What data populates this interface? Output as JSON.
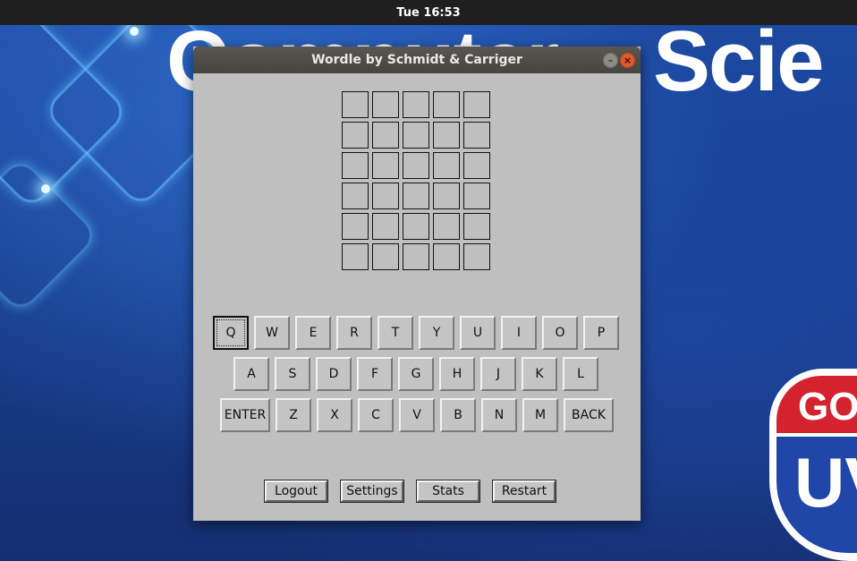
{
  "topbar": {
    "clock": "Tue 16:53"
  },
  "wallpaper": {
    "title_left": "Computer",
    "title_right": "Scie",
    "shield_top": "GO",
    "shield_bottom": "UV"
  },
  "window": {
    "title": "Wordle by Schmidt & Carriger",
    "minimize_icon": "minimize-icon",
    "close_icon": "close-icon",
    "grid": {
      "rows": 6,
      "cols": 5
    },
    "keyboard": {
      "row1": [
        "Q",
        "W",
        "E",
        "R",
        "T",
        "Y",
        "U",
        "I",
        "O",
        "P"
      ],
      "row2": [
        "A",
        "S",
        "D",
        "F",
        "G",
        "H",
        "J",
        "K",
        "L"
      ],
      "row3": [
        "ENTER",
        "Z",
        "X",
        "C",
        "V",
        "B",
        "N",
        "M",
        "BACK"
      ]
    },
    "buttons": {
      "logout": "Logout",
      "settings": "Settings",
      "stats": "Stats",
      "restart": "Restart"
    }
  },
  "colors": {
    "window_bg": "#bfbfbf",
    "titlebar": "#4f4d48",
    "close": "#e25a2b",
    "wallpaper": "#1a3b84"
  }
}
